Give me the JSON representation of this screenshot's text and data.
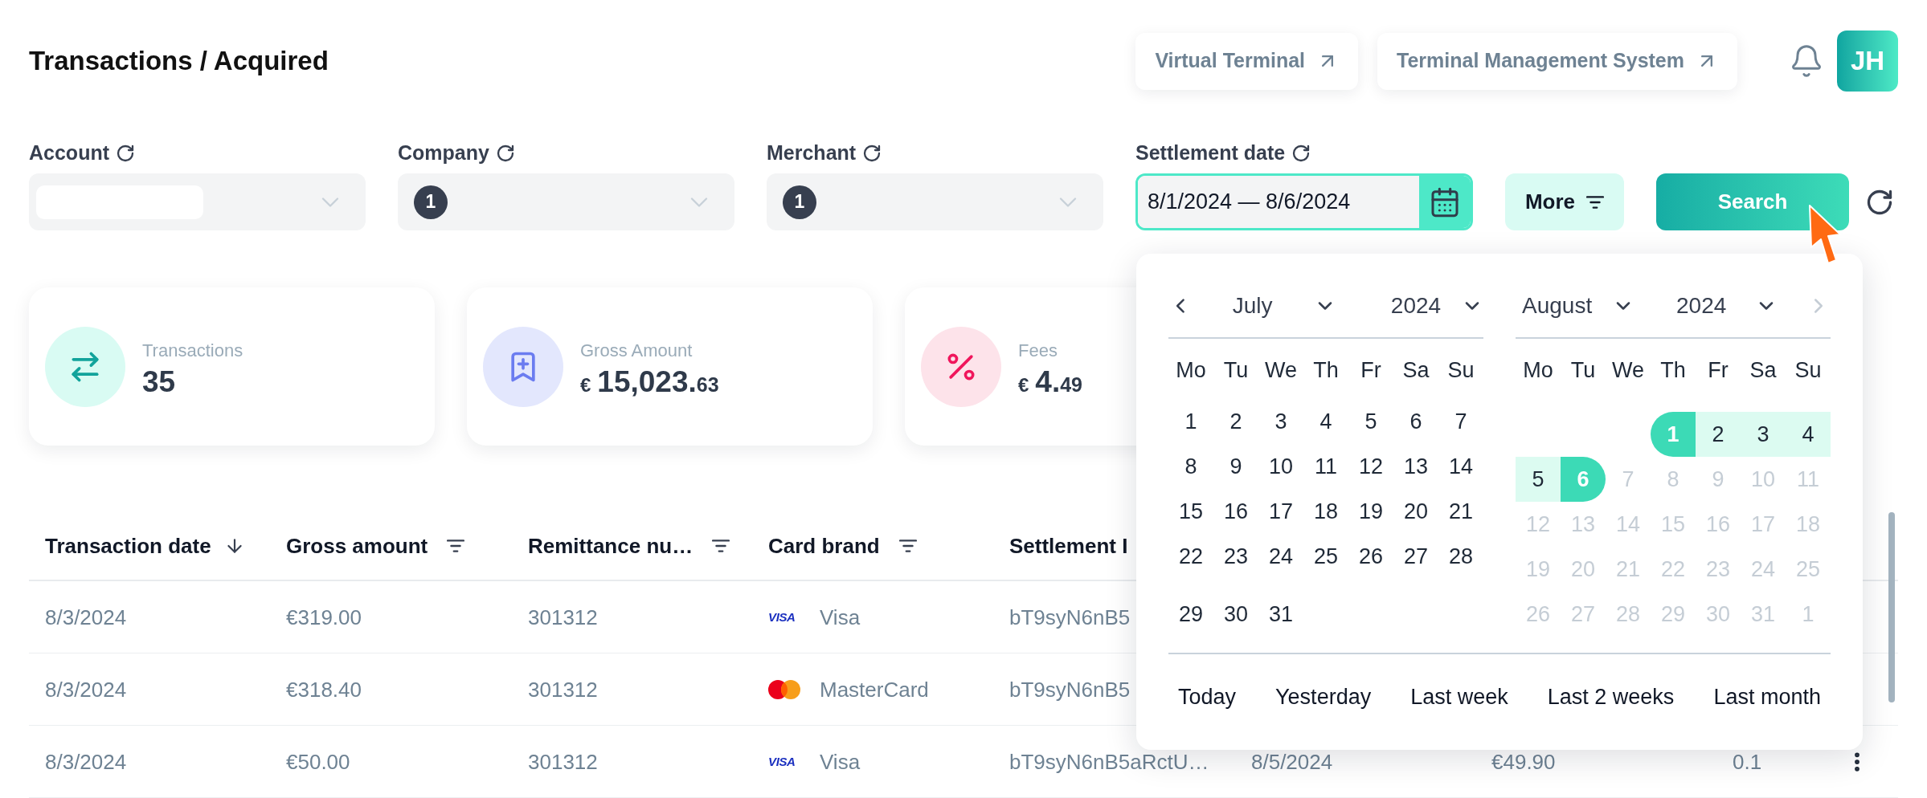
{
  "page_title": "Transactions / Acquired",
  "header_links": [
    "Virtual Terminal",
    "Terminal Management System"
  ],
  "avatar": {
    "initials": "JH"
  },
  "filters": [
    {
      "kind": "select",
      "label": "Account",
      "value": {
        "kind": "redacted"
      }
    },
    {
      "kind": "select",
      "label": "Company",
      "value": {
        "kind": "count",
        "badge": "1"
      }
    },
    {
      "kind": "select",
      "label": "Merchant",
      "value": {
        "kind": "count",
        "badge": "1"
      }
    },
    {
      "kind": "date_range",
      "label": "Settlement date",
      "value": "8/1/2024 — 8/6/2024",
      "open": true
    }
  ],
  "actions": [
    {
      "kind": "more",
      "label": "More"
    },
    {
      "kind": "search",
      "label": "Search"
    },
    {
      "kind": "reset"
    }
  ],
  "stats": [
    {
      "kind": "transactions",
      "label": "Transactions",
      "value": {
        "whole": "35"
      }
    },
    {
      "kind": "gross",
      "label": "Gross Amount",
      "value": {
        "currency": "€",
        "whole": "15,023.",
        "fraction": "63"
      }
    },
    {
      "kind": "fees",
      "label": "Fees",
      "value": {
        "currency": "€",
        "whole": "4.",
        "fraction": "49"
      }
    }
  ],
  "table": {
    "columns": [
      {
        "label": "Transaction date",
        "kind": "sort"
      },
      {
        "label": "Gross amount",
        "kind": "filter"
      },
      {
        "label": "Remittance nu…",
        "kind": "filter"
      },
      {
        "label": "Card brand",
        "kind": "filter"
      },
      {
        "label": "Settlement I",
        "kind": "plain"
      }
    ],
    "rows": [
      {
        "cells": [
          {
            "kind": "text",
            "text": "8/3/2024"
          },
          {
            "kind": "text",
            "text": "€319.00"
          },
          {
            "kind": "text",
            "text": "301312"
          },
          {
            "kind": "visa",
            "logo_text": "VISA",
            "text": "Visa"
          },
          {
            "kind": "text",
            "text": "bT9syN6nB5"
          }
        ]
      },
      {
        "cells": [
          {
            "kind": "text",
            "text": "8/3/2024"
          },
          {
            "kind": "text",
            "text": "€318.40"
          },
          {
            "kind": "text",
            "text": "301312"
          },
          {
            "kind": "mastercard",
            "text": "MasterCard"
          },
          {
            "kind": "text",
            "text": "bT9syN6nB5"
          }
        ]
      },
      {
        "cells": [
          {
            "kind": "text",
            "text": "8/3/2024"
          },
          {
            "kind": "text",
            "text": "€50.00"
          },
          {
            "kind": "text",
            "text": "301312"
          },
          {
            "kind": "visa",
            "logo_text": "VISA",
            "text": "Visa"
          },
          {
            "kind": "text",
            "text": "bT9syN6nB5aRctU…"
          },
          {
            "kind": "text",
            "text": "8/5/2024"
          },
          {
            "kind": "text",
            "text": "€49.90"
          },
          {
            "kind": "text",
            "text": "0.1"
          },
          {
            "kind": "menu"
          }
        ]
      }
    ]
  },
  "date_picker": {
    "months": [
      {
        "nav": {
          "kind": "prev",
          "disabled": false
        },
        "month": "July",
        "year": "2024",
        "weekdays": [
          "Mo",
          "Tu",
          "We",
          "Th",
          "Fr",
          "Sa",
          "Su"
        ],
        "weeks": [
          [
            {
              "label": "1",
              "selected": false,
              "in_range": false,
              "disabled": false
            },
            {
              "label": "2",
              "selected": false,
              "in_range": false,
              "disabled": false
            },
            {
              "label": "3",
              "selected": false,
              "in_range": false,
              "disabled": false
            },
            {
              "label": "4",
              "selected": false,
              "in_range": false,
              "disabled": false
            },
            {
              "label": "5",
              "selected": false,
              "in_range": false,
              "disabled": false
            },
            {
              "label": "6",
              "selected": false,
              "in_range": false,
              "disabled": false
            },
            {
              "label": "7",
              "selected": false,
              "in_range": false,
              "disabled": false
            }
          ],
          [
            {
              "label": "8",
              "selected": false,
              "in_range": false,
              "disabled": false
            },
            {
              "label": "9",
              "selected": false,
              "in_range": false,
              "disabled": false
            },
            {
              "label": "10",
              "selected": false,
              "in_range": false,
              "disabled": false
            },
            {
              "label": "11",
              "selected": false,
              "in_range": false,
              "disabled": false
            },
            {
              "label": "12",
              "selected": false,
              "in_range": false,
              "disabled": false
            },
            {
              "label": "13",
              "selected": false,
              "in_range": false,
              "disabled": false
            },
            {
              "label": "14",
              "selected": false,
              "in_range": false,
              "disabled": false
            }
          ],
          [
            {
              "label": "15",
              "selected": false,
              "in_range": false,
              "disabled": false
            },
            {
              "label": "16",
              "selected": false,
              "in_range": false,
              "disabled": false
            },
            {
              "label": "17",
              "selected": false,
              "in_range": false,
              "disabled": false
            },
            {
              "label": "18",
              "selected": false,
              "in_range": false,
              "disabled": false
            },
            {
              "label": "19",
              "selected": false,
              "in_range": false,
              "disabled": false
            },
            {
              "label": "20",
              "selected": false,
              "in_range": false,
              "disabled": false
            },
            {
              "label": "21",
              "selected": false,
              "in_range": false,
              "disabled": false
            }
          ],
          [
            {
              "label": "22",
              "selected": false,
              "in_range": false,
              "disabled": false
            },
            {
              "label": "23",
              "selected": false,
              "in_range": false,
              "disabled": false
            },
            {
              "label": "24",
              "selected": false,
              "in_range": false,
              "disabled": false
            },
            {
              "label": "25",
              "selected": false,
              "in_range": false,
              "disabled": false
            },
            {
              "label": "26",
              "selected": false,
              "in_range": false,
              "disabled": false
            },
            {
              "label": "27",
              "selected": false,
              "in_range": false,
              "disabled": false
            },
            {
              "label": "28",
              "selected": false,
              "in_range": false,
              "disabled": false
            }
          ],
          [
            {
              "label": "29",
              "selected": false,
              "in_range": false,
              "disabled": false
            },
            {
              "label": "30",
              "selected": false,
              "in_range": false,
              "disabled": false
            },
            {
              "label": "31",
              "selected": false,
              "in_range": false,
              "disabled": false
            }
          ]
        ]
      },
      {
        "nav": {
          "kind": "next",
          "disabled": true
        },
        "month": "August",
        "year": "2024",
        "weekdays": [
          "Mo",
          "Tu",
          "We",
          "Th",
          "Fr",
          "Sa",
          "Su"
        ],
        "weeks": [
          [
            {
              "label": "1",
              "selected": true,
              "in_range": false,
              "disabled": false
            },
            {
              "label": "2",
              "selected": false,
              "in_range": true,
              "disabled": false
            },
            {
              "label": "3",
              "selected": false,
              "in_range": true,
              "disabled": false
            },
            {
              "label": "4",
              "selected": false,
              "in_range": true,
              "disabled": false
            }
          ],
          [
            {
              "label": "5",
              "selected": false,
              "in_range": true,
              "disabled": false
            },
            {
              "label": "6",
              "selected": true,
              "in_range": false,
              "disabled": false
            },
            {
              "label": "7",
              "selected": false,
              "in_range": false,
              "disabled": true
            },
            {
              "label": "8",
              "selected": false,
              "in_range": false,
              "disabled": true
            },
            {
              "label": "9",
              "selected": false,
              "in_range": false,
              "disabled": true
            },
            {
              "label": "10",
              "selected": false,
              "in_range": false,
              "disabled": true
            },
            {
              "label": "11",
              "selected": false,
              "in_range": false,
              "disabled": true
            }
          ],
          [
            {
              "label": "12",
              "selected": false,
              "in_range": false,
              "disabled": true
            },
            {
              "label": "13",
              "selected": false,
              "in_range": false,
              "disabled": true
            },
            {
              "label": "14",
              "selected": false,
              "in_range": false,
              "disabled": true
            },
            {
              "label": "15",
              "selected": false,
              "in_range": false,
              "disabled": true
            },
            {
              "label": "16",
              "selected": false,
              "in_range": false,
              "disabled": true
            },
            {
              "label": "17",
              "selected": false,
              "in_range": false,
              "disabled": true
            },
            {
              "label": "18",
              "selected": false,
              "in_range": false,
              "disabled": true
            }
          ],
          [
            {
              "label": "19",
              "selected": false,
              "in_range": false,
              "disabled": true
            },
            {
              "label": "20",
              "selected": false,
              "in_range": false,
              "disabled": true
            },
            {
              "label": "21",
              "selected": false,
              "in_range": false,
              "disabled": true
            },
            {
              "label": "22",
              "selected": false,
              "in_range": false,
              "disabled": true
            },
            {
              "label": "23",
              "selected": false,
              "in_range": false,
              "disabled": true
            },
            {
              "label": "24",
              "selected": false,
              "in_range": false,
              "disabled": true
            },
            {
              "label": "25",
              "selected": false,
              "in_range": false,
              "disabled": true
            }
          ],
          [
            {
              "label": "26",
              "selected": false,
              "in_range": false,
              "disabled": true
            },
            {
              "label": "27",
              "selected": false,
              "in_range": false,
              "disabled": true
            },
            {
              "label": "28",
              "selected": false,
              "in_range": false,
              "disabled": true
            },
            {
              "label": "29",
              "selected": false,
              "in_range": false,
              "disabled": true
            },
            {
              "label": "30",
              "selected": false,
              "in_range": false,
              "disabled": true
            },
            {
              "label": "31",
              "selected": false,
              "in_range": false,
              "disabled": true
            },
            {
              "label": "1",
              "selected": false,
              "in_range": false,
              "disabled": true
            }
          ]
        ]
      }
    ],
    "presets": [
      "Today",
      "Yesterday",
      "Last week",
      "Last 2 weeks",
      "Last month"
    ]
  }
}
